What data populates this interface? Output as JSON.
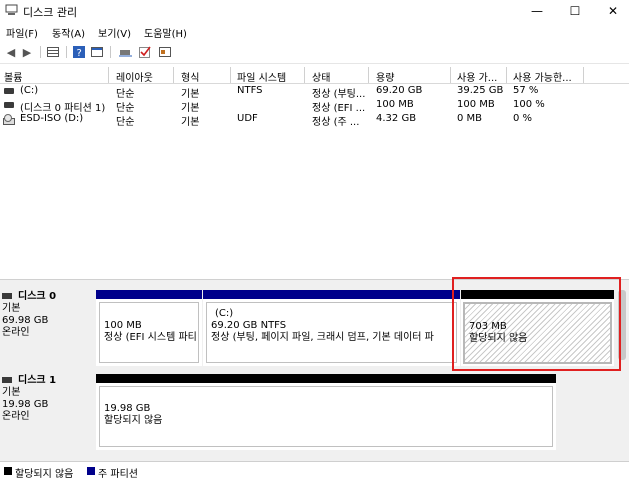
{
  "window": {
    "title": "디스크 관리",
    "min": "—",
    "max": "☐",
    "close": "✕"
  },
  "menu": [
    "파일(F)",
    "동작(A)",
    "보기(V)",
    "도움말(H)"
  ],
  "volumes": {
    "columns": [
      "볼륨",
      "레이아웃",
      "형식",
      "파일 시스템",
      "상태",
      "용량",
      "사용 가...",
      "사용 가능한..."
    ],
    "rows": [
      [
        "(C:)",
        "단순",
        "기본",
        "NTFS",
        "정상 (부팅...",
        "69.20 GB",
        "39.25 GB",
        "57 %"
      ],
      [
        "(디스크 0 파티션 1)",
        "단순",
        "기본",
        "",
        "정상 (EFI ...",
        "100 MB",
        "100 MB",
        "100 %"
      ],
      [
        "ESD-ISO (D:)",
        "단순",
        "기본",
        "UDF",
        "정상 (주 ...",
        "4.32 GB",
        "0 MB",
        "0 %"
      ]
    ]
  },
  "disks": [
    {
      "name": "디스크 0",
      "type": "기본",
      "size": "69.98 GB",
      "status": "온라인",
      "partitions": [
        {
          "title": "",
          "line1": "100 MB",
          "line2": "정상 (EFI 시스템 파티",
          "bar_color": "#00008b"
        },
        {
          "title": "(C:)",
          "line1": "69.20 GB NTFS",
          "line2": "정상 (부팅, 페이지 파일, 크래시 덤프, 기본 데이터 파",
          "bar_color": "#00008b"
        },
        {
          "title": "",
          "line1": "703 MB",
          "line2": "할당되지 않음",
          "bar_color": "#000000"
        }
      ]
    },
    {
      "name": "디스크 1",
      "type": "기본",
      "size": "19.98 GB",
      "status": "온라인",
      "partitions": [
        {
          "title": "",
          "line1": "19.98 GB",
          "line2": "할당되지 않음",
          "bar_color": "#000000"
        }
      ]
    }
  ],
  "legend": [
    {
      "label": "할당되지 않음",
      "color": "#000000"
    },
    {
      "label": "주 파티션",
      "color": "#00008b"
    }
  ]
}
